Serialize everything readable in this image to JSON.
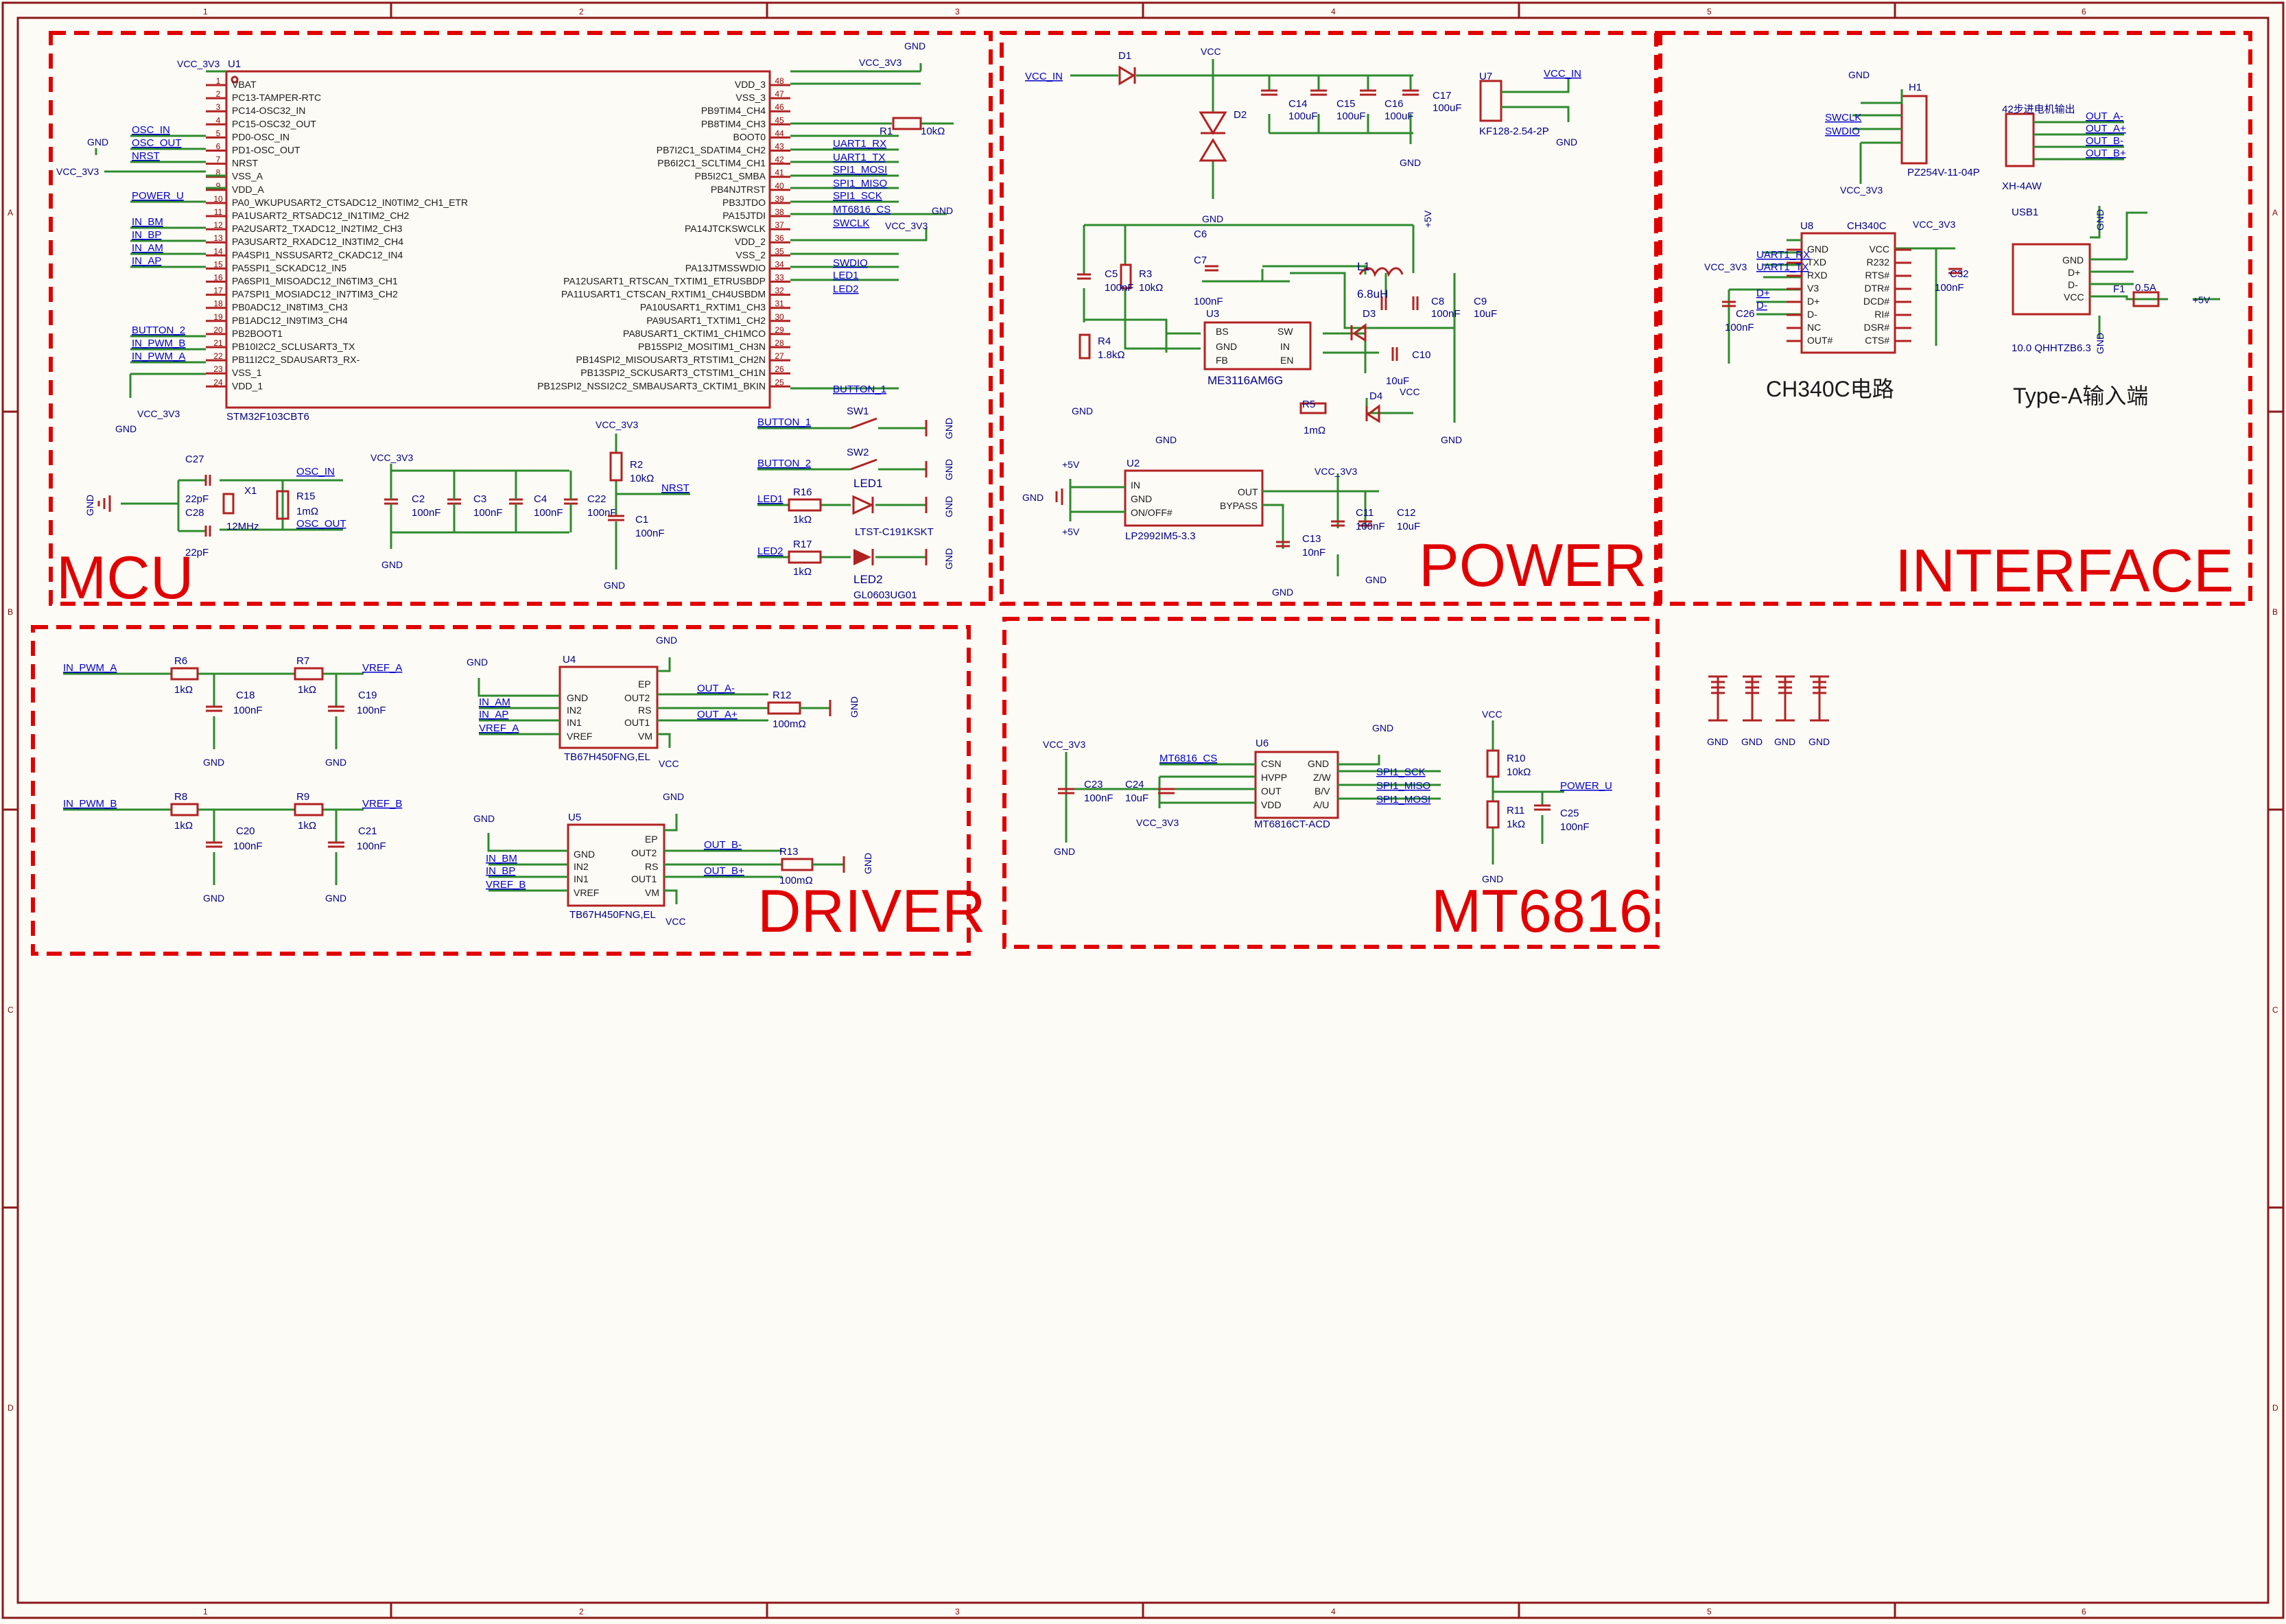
{
  "sections": {
    "mcu": "MCU",
    "power": "POWER",
    "interface": "INTERFACE",
    "driver": "DRIVER",
    "mt6816": "MT6816"
  },
  "border": {
    "cols": [
      "1",
      "2",
      "3",
      "4",
      "5",
      "6"
    ],
    "rows": [
      "A",
      "B",
      "C",
      "D"
    ]
  },
  "mcu": {
    "ref": "U1",
    "part": "STM32F103CBT6",
    "left_pins": [
      {
        "n": "1",
        "name": "VBAT"
      },
      {
        "n": "2",
        "name": "PC13-TAMPER-RTC"
      },
      {
        "n": "3",
        "name": "PC14-OSC32_IN"
      },
      {
        "n": "4",
        "name": "PC15-OSC32_OUT"
      },
      {
        "n": "5",
        "name": "PD0-OSC_IN"
      },
      {
        "n": "6",
        "name": "PD1-OSC_OUT"
      },
      {
        "n": "7",
        "name": "NRST"
      },
      {
        "n": "8",
        "name": "VSS_A"
      },
      {
        "n": "9",
        "name": "VDD_A"
      },
      {
        "n": "10",
        "name": "PA0_WKUPUSART2_CTSADC12_IN0TIM2_CH1_ETR"
      },
      {
        "n": "11",
        "name": "PA1USART2_RTSADC12_IN1TIM2_CH2"
      },
      {
        "n": "12",
        "name": "PA2USART2_TXADC12_IN2TIM2_CH3"
      },
      {
        "n": "13",
        "name": "PA3USART2_RXADC12_IN3TIM2_CH4"
      },
      {
        "n": "14",
        "name": "PA4SPI1_NSSUSART2_CKADC12_IN4"
      },
      {
        "n": "15",
        "name": "PA5SPI1_SCKADC12_IN5"
      },
      {
        "n": "16",
        "name": "PA6SPI1_MISOADC12_IN6TIM3_CH1"
      },
      {
        "n": "17",
        "name": "PA7SPI1_MOSIADC12_IN7TIM3_CH2"
      },
      {
        "n": "18",
        "name": "PB0ADC12_IN8TIM3_CH3"
      },
      {
        "n": "19",
        "name": "PB1ADC12_IN9TIM3_CH4"
      },
      {
        "n": "20",
        "name": "PB2BOOT1"
      },
      {
        "n": "21",
        "name": "PB10I2C2_SCLUSART3_TX"
      },
      {
        "n": "22",
        "name": "PB11I2C2_SDAUSART3_RX-"
      },
      {
        "n": "23",
        "name": "VSS_1"
      },
      {
        "n": "24",
        "name": "VDD_1"
      }
    ],
    "right_pins": [
      {
        "n": "48",
        "name": "VDD_3"
      },
      {
        "n": "47",
        "name": "VSS_3"
      },
      {
        "n": "46",
        "name": "PB9TIM4_CH4"
      },
      {
        "n": "45",
        "name": "PB8TIM4_CH3"
      },
      {
        "n": "44",
        "name": "BOOT0"
      },
      {
        "n": "43",
        "name": "PB7I2C1_SDATIM4_CH2"
      },
      {
        "n": "42",
        "name": "PB6I2C1_SCLTIM4_CH1"
      },
      {
        "n": "41",
        "name": "PB5I2C1_SMBA"
      },
      {
        "n": "40",
        "name": "PB4NJTRST"
      },
      {
        "n": "39",
        "name": "PB3JTDO"
      },
      {
        "n": "38",
        "name": "PA15JTDI"
      },
      {
        "n": "37",
        "name": "PA14JTCKSWCLK"
      },
      {
        "n": "36",
        "name": "VDD_2"
      },
      {
        "n": "35",
        "name": "VSS_2"
      },
      {
        "n": "34",
        "name": "PA13JTMSSWDIO"
      },
      {
        "n": "33",
        "name": "PA12USART1_RTSCAN_TXTIM1_ETRUSBDP"
      },
      {
        "n": "32",
        "name": "PA11USART1_CTSCAN_RXTIM1_CH4USBDM"
      },
      {
        "n": "31",
        "name": "PA10USART1_RXTIM1_CH3"
      },
      {
        "n": "30",
        "name": "PA9USART1_TXTIM1_CH2"
      },
      {
        "n": "29",
        "name": "PA8USART1_CKTIM1_CH1MCO"
      },
      {
        "n": "28",
        "name": "PB15SPI2_MOSITIM1_CH3N"
      },
      {
        "n": "27",
        "name": "PB14SPI2_MISOUSART3_RTSTIM1_CH2N"
      },
      {
        "n": "26",
        "name": "PB13SPI2_SCKUSART3_CTSTIM1_CH1N"
      },
      {
        "n": "25",
        "name": "PB12SPI2_NSSI2C2_SMBAUSART3_CKTIM1_BKIN"
      }
    ],
    "left_nets": [
      "OSC_IN",
      "OSC_OUT",
      "NRST",
      "POWER_U",
      "IN_BM",
      "IN_BP",
      "IN_AM",
      "IN_AP",
      "BUTTON_2",
      "IN_PWM_B",
      "IN_PWM_A"
    ],
    "right_nets": [
      "UART1_RX",
      "UART1_TX",
      "SPI1_MOSI",
      "SPI1_MISO",
      "SPI1_SCK",
      "MT6816_CS",
      "SWCLK",
      "SWDIO",
      "LED1",
      "LED2",
      "BUTTON_1"
    ],
    "power_labels": {
      "vcc3v3": "VCC_3V3",
      "gnd": "GND"
    },
    "r1": {
      "ref": "R1",
      "value": "10kΩ"
    },
    "crystal": {
      "c27": "C27",
      "c28": "C28",
      "c27v": "22pF",
      "c28v": "22pF",
      "x1": "X1",
      "x1v": "12MHz",
      "r15": "R15",
      "r15v": "1mΩ",
      "osc_in": "OSC_IN",
      "osc_out": "OSC_OUT"
    },
    "decoupling": [
      {
        "ref": "C2",
        "value": "100nF"
      },
      {
        "ref": "C3",
        "value": "100nF"
      },
      {
        "ref": "C4",
        "value": "100nF"
      },
      {
        "ref": "C22",
        "value": "100nF"
      }
    ],
    "reset": {
      "r2": "R2",
      "r2v": "10kΩ",
      "c1": "C1",
      "c1v": "100nF",
      "net": "NRST"
    },
    "buttons": [
      {
        "net": "BUTTON_1",
        "ref": "SW1"
      },
      {
        "net": "BUTTON_2",
        "ref": "SW2"
      }
    ],
    "leds": [
      {
        "net": "LED1",
        "r": "R16",
        "rv": "1kΩ",
        "ref": "LED1",
        "part": "LTST-C191KSKT"
      },
      {
        "net": "LED2",
        "r": "R17",
        "rv": "1kΩ",
        "ref": "LED2",
        "part": "GL0603UG01"
      }
    ]
  },
  "power": {
    "vcc_in": "VCC_IN",
    "vcc": "VCC",
    "d1": "D1",
    "d2": "D2",
    "bulk_caps": [
      {
        "ref": "C14",
        "value": "100uF"
      },
      {
        "ref": "C15",
        "value": "100uF"
      },
      {
        "ref": "C16",
        "value": "100uF"
      },
      {
        "ref": "C17",
        "value": "100uF"
      }
    ],
    "u7": {
      "ref": "U7",
      "part": "KF128-2.54-2P",
      "net": "VCC_IN",
      "gnd": "GND"
    },
    "buck": {
      "ref": "U3",
      "part": "ME3116AM6G",
      "pins": [
        "BS",
        "GND",
        "FB",
        "SW",
        "IN",
        "EN"
      ],
      "c5": "C5",
      "c5v": "100nF",
      "c6": "C6",
      "c7": "C7",
      "c7v": "100nF",
      "r3": "R3",
      "r3v": "10kΩ",
      "r4": "R4",
      "r4v": "1.8kΩ",
      "l1": "L1",
      "l1v": "6.8uH",
      "d3": "D3",
      "d4": "D4",
      "c8": "C8",
      "c8v": "100nF",
      "c9": "C9",
      "c9v": "10uF",
      "c10": "C10",
      "c10v": "10uF",
      "r5": "R5",
      "r5v": "1mΩ",
      "plus5": "+5V",
      "vcc": "VCC"
    },
    "ldo": {
      "ref": "U2",
      "part": "LP2992IM5-3.3",
      "pins": [
        "IN",
        "GND",
        "ON/OFF#",
        "OUT",
        "BYPASS"
      ],
      "c13": "C13",
      "c13v": "10nF",
      "c11": "C11",
      "c11v": "100nF",
      "c12": "C12",
      "c12v": "10uF",
      "vcc3v3": "VCC_3V3",
      "plus5": "+5V"
    }
  },
  "interface": {
    "h1": {
      "ref": "H1",
      "part": "PZ254V-11-04P",
      "nets": [
        "SWCLK",
        "SWDIO"
      ],
      "gnd": "GND",
      "vcc": "VCC_3V3"
    },
    "xh": {
      "title": "42步进电机输出",
      "part": "XH-4AW",
      "nets": [
        "OUT_A-",
        "OUT_A+",
        "OUT_B-",
        "OUT_B+"
      ]
    },
    "ch340": {
      "ref": "U8",
      "part": "CH340C",
      "left": [
        "GND",
        "TXD",
        "RXD",
        "V3",
        "D+",
        "D-",
        "NC",
        "OUT#"
      ],
      "right": [
        "VCC",
        "R232",
        "RTS#",
        "DTR#",
        "DCD#",
        "RI#",
        "DSR#",
        "CTS#"
      ],
      "nets": [
        "UART1_RX",
        "UART1_TX",
        "D+",
        "D-"
      ],
      "c26": "C26",
      "c26v": "100nF",
      "c32": "C32",
      "c32v": "100nF",
      "vcc": "VCC_3V3",
      "gnd": "GND"
    },
    "usb": {
      "ref": "USB1",
      "part": "10.0 QHHTZB6.3",
      "pins": [
        "GND",
        "D+",
        "D-",
        "VCC"
      ],
      "f1": "F1",
      "f1v": "0.5A",
      "plus5": "+5V",
      "gnd": "GND"
    },
    "ch340_caption": "CH340C电路",
    "usb_caption": "Type-A输入端"
  },
  "driver": {
    "rc": [
      {
        "in": "IN_PWM_A",
        "r1": "R6",
        "r1v": "1kΩ",
        "c1": "C18",
        "c1v": "100nF",
        "r2": "R7",
        "r2v": "1kΩ",
        "c2": "C19",
        "c2v": "100nF",
        "out": "VREF_A"
      },
      {
        "in": "IN_PWM_B",
        "r1": "R8",
        "r1v": "1kΩ",
        "c1": "C20",
        "c1v": "100nF",
        "r2": "R9",
        "r2v": "1kΩ",
        "c2": "C21",
        "c2v": "100nF",
        "out": "VREF_B"
      }
    ],
    "chips": [
      {
        "ref": "U4",
        "part": "TB67H450FNG,EL",
        "left": [
          "GND",
          "IN2",
          "IN1",
          "VREF"
        ],
        "right": [
          "EP",
          "OUT2",
          "RS",
          "OUT1",
          "VM"
        ],
        "nets": [
          "IN_AM",
          "IN_AP",
          "VREF_A"
        ],
        "outs": [
          "OUT_A-",
          "OUT_A+"
        ],
        "r": "R12",
        "rv": "100mΩ"
      },
      {
        "ref": "U5",
        "part": "TB67H450FNG,EL",
        "left": [
          "GND",
          "IN2",
          "IN1",
          "VREF"
        ],
        "right": [
          "EP",
          "OUT2",
          "RS",
          "OUT1",
          "VM"
        ],
        "nets": [
          "IN_BM",
          "IN_BP",
          "VREF_B"
        ],
        "outs": [
          "OUT_B-",
          "OUT_B+"
        ],
        "r": "R13",
        "rv": "100mΩ"
      }
    ],
    "gnd": "GND",
    "vcc": "VCC"
  },
  "mt6816": {
    "ref": "U6",
    "part": "MT6816CT-ACD",
    "left": [
      "CSN",
      "HVPP",
      "OUT",
      "VDD"
    ],
    "right": [
      "GND",
      "Z/W",
      "B/V",
      "A/U"
    ],
    "cs": "MT6816_CS",
    "nets": [
      "SPI1_SCK",
      "SPI1_MISO",
      "SPI1_MOSI"
    ],
    "c23": "C23",
    "c23v": "100nF",
    "c24": "C24",
    "c24v": "10uF",
    "vcc3v3": "VCC_3V3",
    "gnd": "GND",
    "vcc": "VCC",
    "r10": "R10",
    "r10v": "10kΩ",
    "r11": "R11",
    "r11v": "1kΩ",
    "c25": "C25",
    "c25v": "100nF",
    "power_u": "POWER_U"
  },
  "mounting": {
    "labels": [
      "GND",
      "GND",
      "GND",
      "GND"
    ]
  }
}
